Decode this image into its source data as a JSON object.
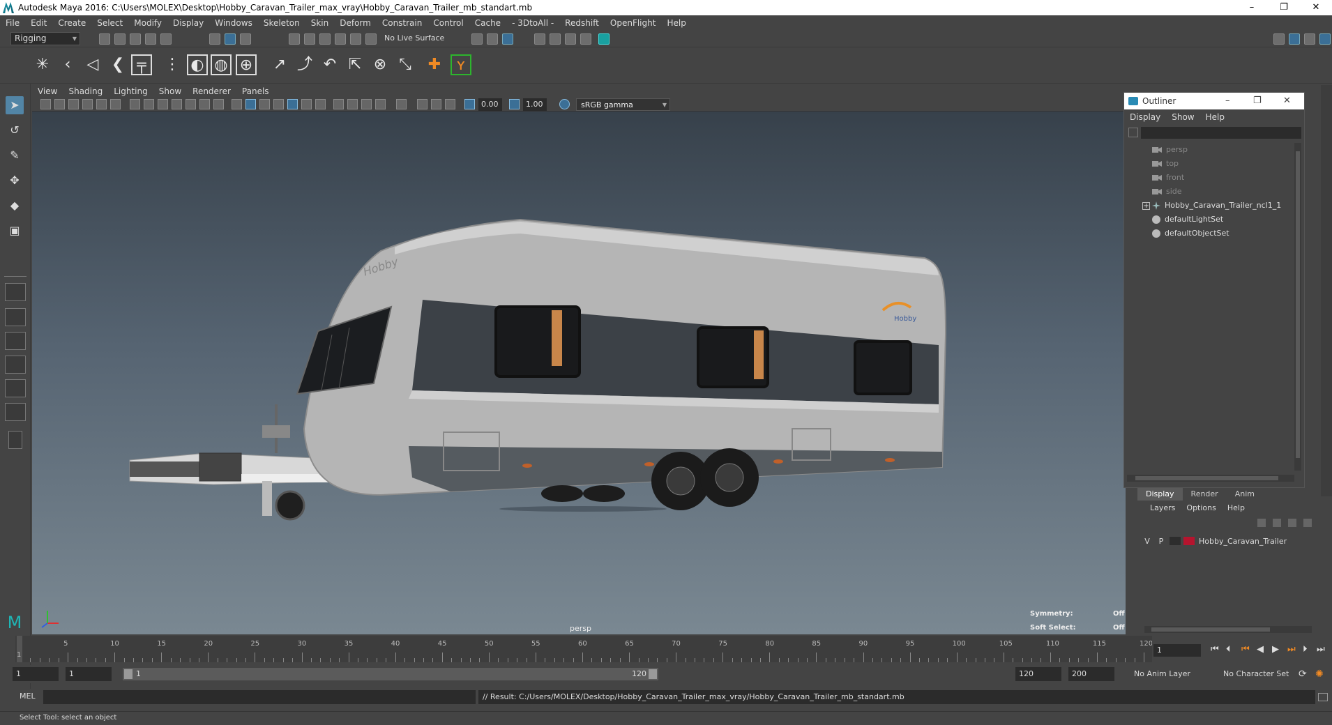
{
  "window": {
    "title": "Autodesk Maya 2016: C:\\Users\\MOLEX\\Desktop\\Hobby_Caravan_Trailer_max_vray\\Hobby_Caravan_Trailer_mb_standart.mb",
    "minimize": "–",
    "maximize": "❐",
    "close": "✕"
  },
  "menubar": [
    "File",
    "Edit",
    "Create",
    "Select",
    "Modify",
    "Display",
    "Windows",
    "Skeleton",
    "Skin",
    "Deform",
    "Constrain",
    "Control",
    "Cache",
    "- 3DtoAll -",
    "Redshift",
    "OpenFlight",
    "Help"
  ],
  "statusline": {
    "mode": "Rigging",
    "live_surface": "No Live Surface"
  },
  "viewport": {
    "menu": [
      "View",
      "Shading",
      "Lighting",
      "Show",
      "Renderer",
      "Panels"
    ],
    "near_value": "0.00",
    "far_value": "1.00",
    "color_space": "sRGB gamma",
    "camera_label": "persp",
    "symmetry_label": "Symmetry:",
    "symmetry_value": "Off",
    "soft_select_label": "Soft Select:",
    "soft_select_value": "Off",
    "model_brand": "Hobby"
  },
  "outliner": {
    "title": "Outliner",
    "menu": [
      "Display",
      "Show",
      "Help"
    ],
    "items": [
      {
        "label": "persp",
        "type": "camera",
        "dim": true
      },
      {
        "label": "top",
        "type": "camera",
        "dim": true
      },
      {
        "label": "front",
        "type": "camera",
        "dim": true
      },
      {
        "label": "side",
        "type": "camera",
        "dim": true
      },
      {
        "label": "Hobby_Caravan_Trailer_ncl1_1",
        "type": "group",
        "dim": false,
        "expander": "+"
      },
      {
        "label": "defaultLightSet",
        "type": "set",
        "dim": false
      },
      {
        "label": "defaultObjectSet",
        "type": "set",
        "dim": false
      }
    ]
  },
  "layers": {
    "tabs": [
      "Display",
      "Render",
      "Anim"
    ],
    "active_tab": "Display",
    "menu": [
      "Layers",
      "Options",
      "Help"
    ],
    "rows": [
      {
        "v": "V",
        "p": "P",
        "name": "Hobby_Caravan_Trailer",
        "color": "#b5142e"
      }
    ]
  },
  "timeslider": {
    "labels": [
      "5",
      "10",
      "15",
      "20",
      "25",
      "30",
      "35",
      "40",
      "45",
      "50",
      "55",
      "60",
      "65",
      "70",
      "75",
      "80",
      "85",
      "90",
      "95",
      "100",
      "105",
      "110",
      "115",
      "120"
    ],
    "current_label": "1",
    "current_frame": "1"
  },
  "range": {
    "start": "1",
    "current": "1",
    "range_start_inner": "1",
    "range_end_inner": "120",
    "end": "120",
    "max_end": "200",
    "anim_layer": "No Anim Layer",
    "character_set": "No Character Set"
  },
  "cmdline": {
    "lang": "MEL",
    "result": "// Result: C:/Users/MOLEX/Desktop/Hobby_Caravan_Trailer_max_vray/Hobby_Caravan_Trailer_mb_standart.mb"
  },
  "helpline": "Select Tool: select an object"
}
